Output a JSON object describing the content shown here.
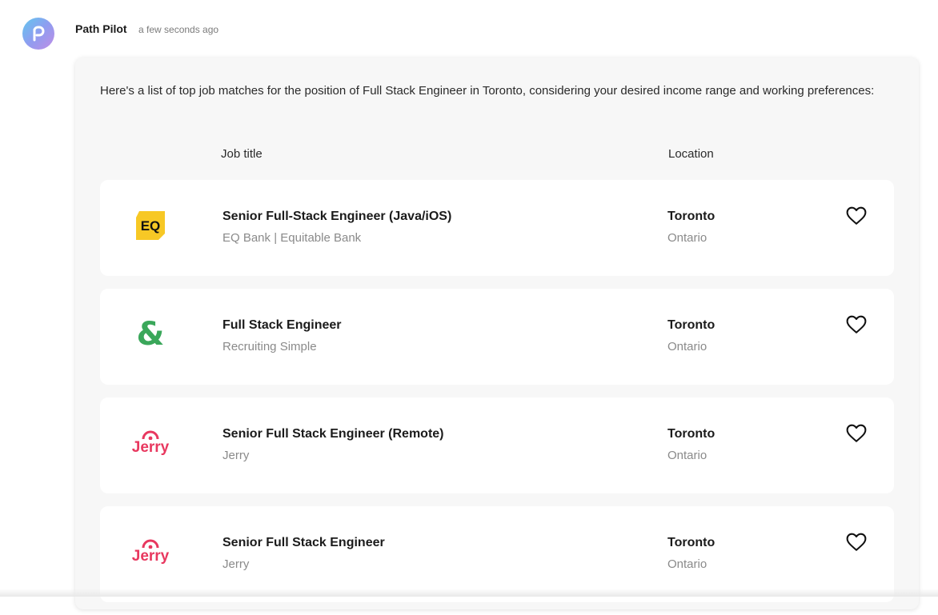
{
  "message": {
    "sender": "Path Pilot",
    "timestamp": "a few seconds ago",
    "intro": "Here's a list of top job matches for the position of Full Stack Engineer in Toronto, considering your desired income range and working preferences:"
  },
  "table": {
    "headers": {
      "job_title": "Job title",
      "location": "Location"
    },
    "jobs": [
      {
        "title": "Senior Full-Stack Engineer (Java/iOS)",
        "company": "EQ Bank | Equitable Bank",
        "city": "Toronto",
        "region": "Ontario",
        "logo": "eq-bank-logo",
        "logo_text": "EQ"
      },
      {
        "title": "Full Stack Engineer",
        "company": "Recruiting Simple",
        "city": "Toronto",
        "region": "Ontario",
        "logo": "recruiting-simple-logo",
        "logo_text": "&"
      },
      {
        "title": "Senior Full Stack Engineer (Remote)",
        "company": "Jerry",
        "city": "Toronto",
        "region": "Ontario",
        "logo": "jerry-logo",
        "logo_text": "Jerry"
      },
      {
        "title": "Senior Full Stack Engineer",
        "company": "Jerry",
        "city": "Toronto",
        "region": "Ontario",
        "logo": "jerry-logo",
        "logo_text": "Jerry"
      }
    ]
  },
  "colors": {
    "eq_yellow": "#f7c825",
    "recruiting_green": "#3aa75a",
    "jerry_pink": "#e8385f",
    "avatar_gradient": [
      "#62c7ee",
      "#c08de6"
    ]
  },
  "icons": {
    "favorite": "heart-outline-icon",
    "avatar": "path-pilot-logo-icon"
  }
}
